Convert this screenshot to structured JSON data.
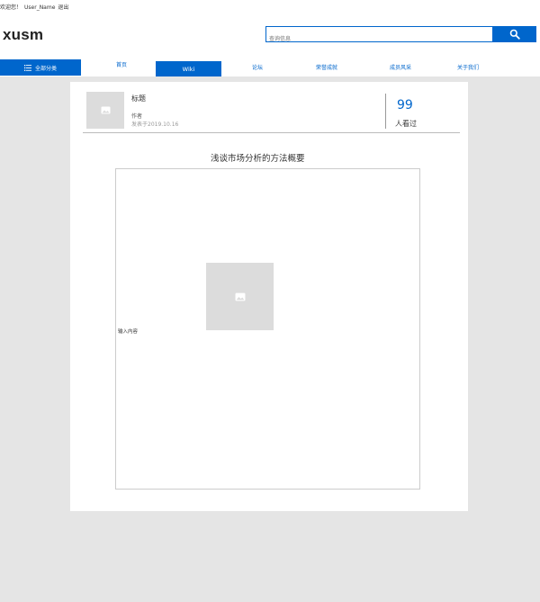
{
  "topbar": {
    "welcome": "欢迎您！",
    "username": "User_Name",
    "logout": "退出"
  },
  "logo": "xusm",
  "search": {
    "placeholder": "查询信息",
    "button_icon": "search-icon"
  },
  "nav": {
    "all_categories": "全部分类",
    "items": [
      "首页",
      "Wiki",
      "论坛",
      "荣誉成就",
      "成员风采",
      "关于我们"
    ],
    "active": "Wiki"
  },
  "post": {
    "title": "标题",
    "author": "作者",
    "date": "发表于2019.10.16",
    "views": "99",
    "views_label": "人看过"
  },
  "article": {
    "title": "浅谈市场分析的方法概要",
    "body_placeholder": "输入内容"
  },
  "colors": {
    "accent": "#0066cc",
    "background": "#e5e5e5",
    "placeholder_image": "#dcdcdc"
  }
}
